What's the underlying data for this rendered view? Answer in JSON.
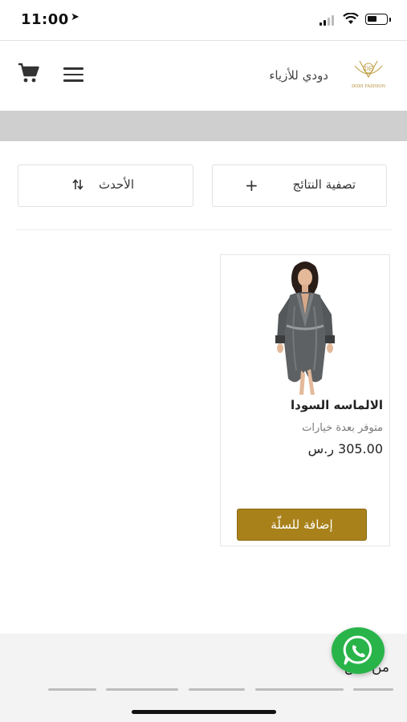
{
  "status_bar": {
    "time": "11:00",
    "location_icon": "location-arrow-icon",
    "battery_level": 0.45
  },
  "header": {
    "brand_name": "دودي للأزياء",
    "logo_text": "DODI FASHION",
    "cart_icon": "cart-icon",
    "menu_icon": "hamburger-menu-icon"
  },
  "toolbar": {
    "filter_label": "تصفية النتائج",
    "filter_icon": "+",
    "sort_label": "الأحدث",
    "sort_icon": "sort-arrows-icon"
  },
  "products": [
    {
      "title": "الالماسه السودا",
      "options_note": "متوفر بعدة خيارات",
      "price": "305.00 ر.س",
      "add_to_cart_label": "إضافة للسلّة"
    }
  ],
  "footer": {
    "heading": "من نحن"
  },
  "colors": {
    "accent": "#a8811a",
    "whatsapp": "#29b44a",
    "band": "#cfcfcf"
  }
}
